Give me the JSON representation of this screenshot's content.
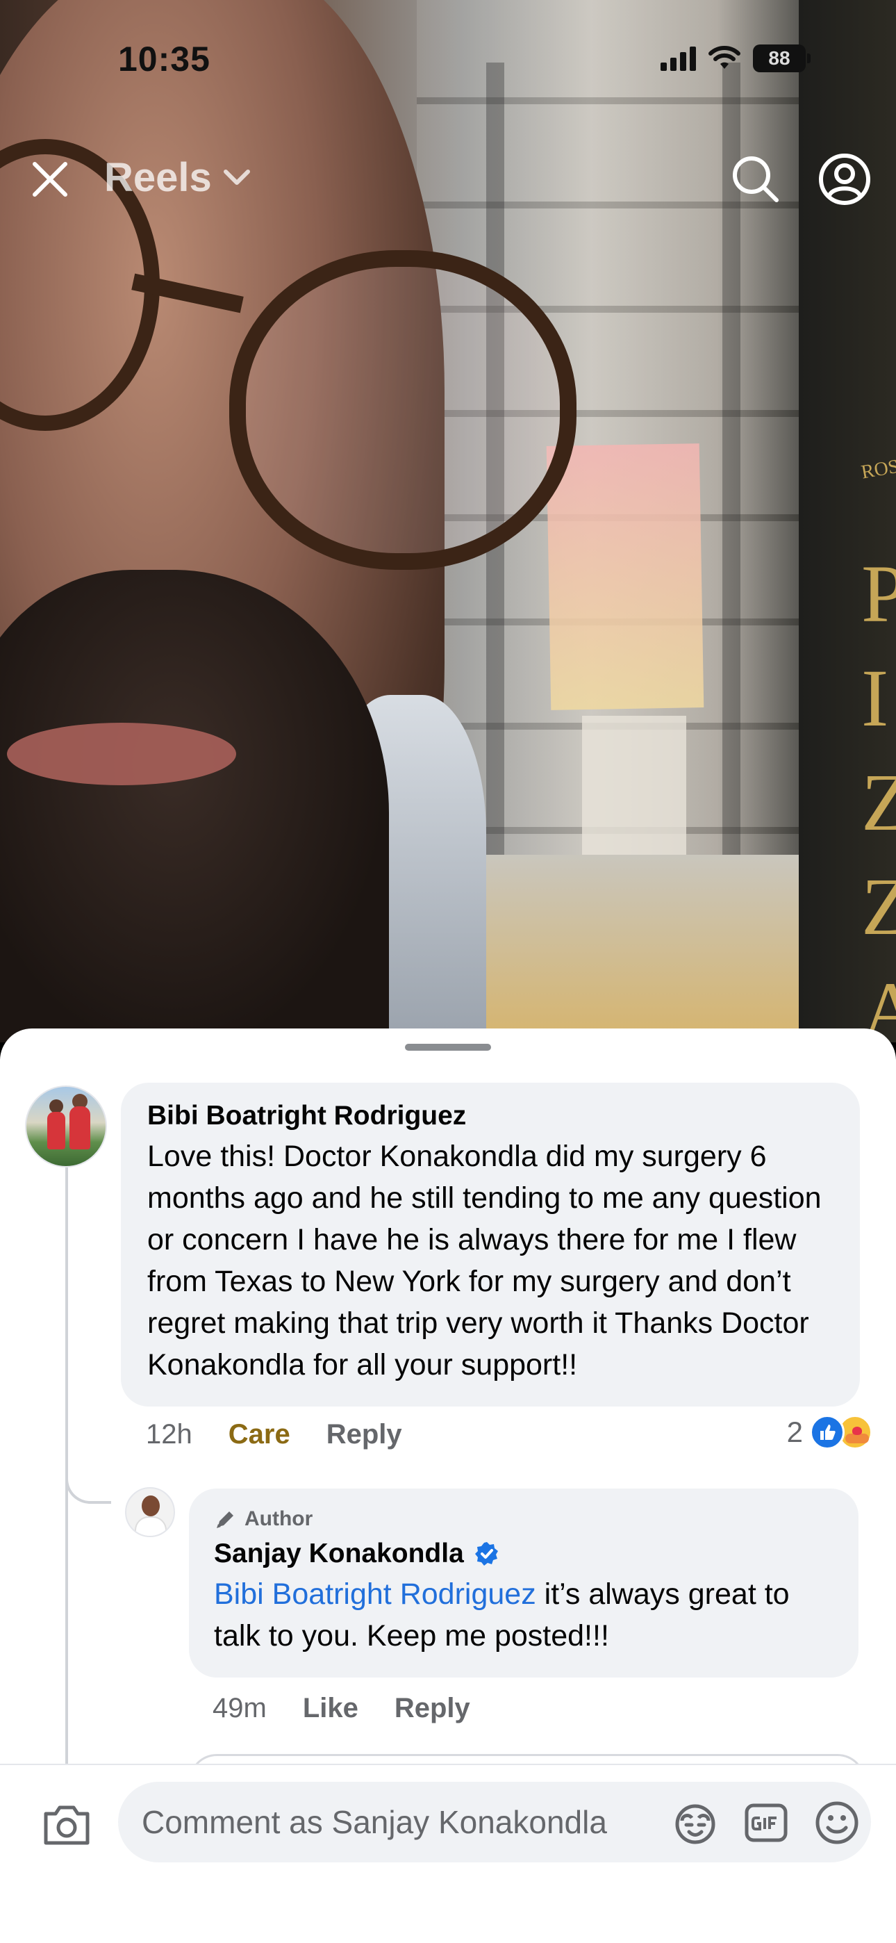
{
  "status_bar": {
    "time": "10:35",
    "battery": "88"
  },
  "top_nav": {
    "title": "Reels",
    "close_icon": "close-icon",
    "search_icon": "search-icon",
    "profile_icon": "profile-icon"
  },
  "video_overlay_text": {
    "sign_small": "ROS",
    "sign_letters": [
      "P",
      "I",
      "Z",
      "Z",
      "A"
    ]
  },
  "comments": [
    {
      "author": "Bibi Boatright Rodriguez",
      "text": "Love this!  Doctor Konakondla did my surgery 6 months ago and he still tending to me any question or concern I have he is always there for me I flew from Texas to New York for my surgery and don’t regret making that trip very worth it Thanks Doctor Konakondla for all your support!!",
      "time": "12h",
      "reaction_label": "Care",
      "reply_label": "Reply",
      "reaction_count": "2",
      "reaction_icons": [
        "like-reaction-icon",
        "care-reaction-icon"
      ]
    }
  ],
  "replies": [
    {
      "badge": "Author",
      "author": "Sanjay Konakondla",
      "verified": true,
      "mention": "Bibi Boatright Rodriguez",
      "text": " it’s always great to talk to you. Keep me posted!!!",
      "time": "49m",
      "like_label": "Like",
      "reply_label": "Reply"
    }
  ],
  "composer": {
    "placeholder": "Comment as Sanjay Konakondla",
    "icons": [
      "camera-icon",
      "avatar-sticker-icon",
      "gif-icon",
      "emoji-icon"
    ]
  },
  "colors": {
    "link": "#216fdb",
    "care": "#8b6a14",
    "like_blue": "#1b74e4",
    "bubble_bg": "#f0f2f5",
    "secondary_text": "#65676b"
  }
}
